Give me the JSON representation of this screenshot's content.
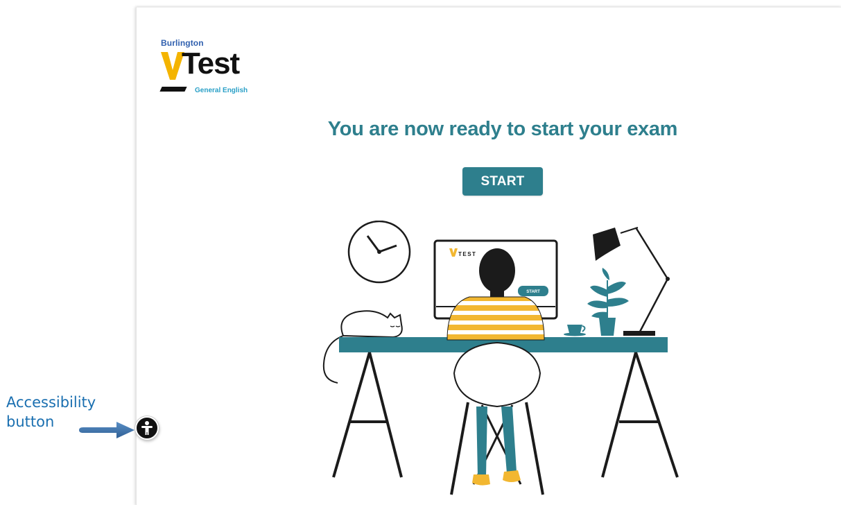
{
  "logo": {
    "top_text": "Burlington",
    "main_text": "Test",
    "sub_text": "General English",
    "v_letter": "V",
    "colors": {
      "accent": "#f4b400",
      "top": "#2f5fae",
      "sub": "#2aa0c7"
    }
  },
  "main": {
    "heading": "You are now ready to start your exam",
    "start_label": "START"
  },
  "illustration": {
    "screen_brand": "TEST",
    "screen_button": "START",
    "colors": {
      "teal": "#2e7f8d",
      "yellow": "#f2b731",
      "dark": "#1b1b1b"
    }
  },
  "annotation": {
    "label": "Accessibility button",
    "icon": "accessibility-icon"
  },
  "colors": {
    "primary": "#2e7f8d",
    "annotation": "#1a6fb0",
    "arrow": "#3a6fa8"
  }
}
